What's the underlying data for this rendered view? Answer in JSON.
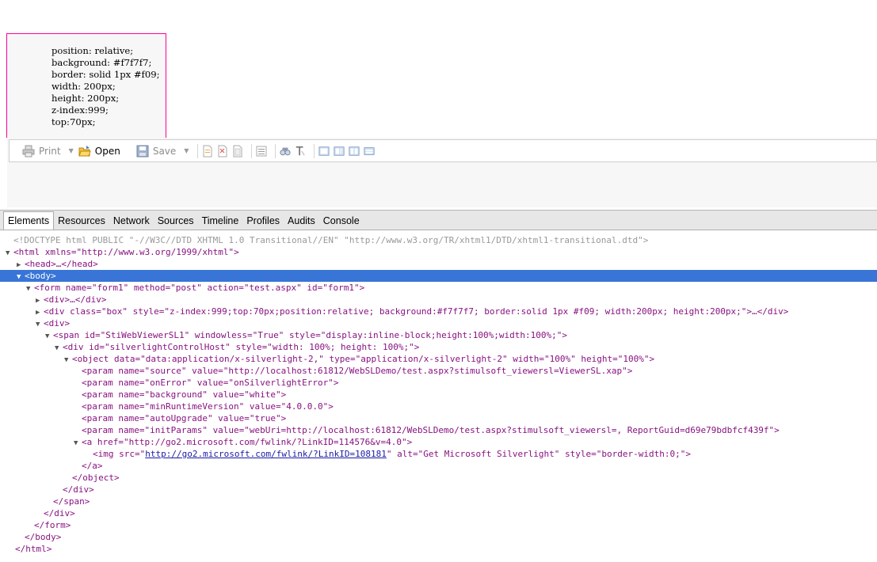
{
  "box": {
    "lines": [
      "position: relative;",
      "background: #f7f7f7;",
      "border: solid 1px #f09;",
      "width: 200px;",
      "height: 200px;",
      "z-index:999;",
      "top:70px;"
    ]
  },
  "toolbar": {
    "print": "Print",
    "open": "Open",
    "save": "Save"
  },
  "devtools": {
    "tabs": [
      "Elements",
      "Resources",
      "Network",
      "Sources",
      "Timeline",
      "Profiles",
      "Audits",
      "Console"
    ],
    "active_tab": "Elements"
  },
  "dom": {
    "doctype": "<!DOCTYPE html PUBLIC \"-//W3C//DTD XHTML 1.0 Transitional//EN\" \"http://www.w3.org/TR/xhtml1/DTD/xhtml1-transitional.dtd\">",
    "html_open": "<html xmlns=\"http://www.w3.org/1999/xhtml\">",
    "head": "<head>…</head>",
    "body_open": "<body>",
    "form_open": "<form name=\"form1\" method=\"post\" action=\"test.aspx\" id=\"form1\">",
    "div_collapsed": "<div>…</div>",
    "div_box": "<div class=\"box\" style=\"z-index:999;top:70px;position:relative; background:#f7f7f7; border:solid 1px #f09; width:200px; height:200px;\">…</div>",
    "div_open": "<div>",
    "span_open": "<span id=\"StiWebViewerSL1\" windowless=\"True\" style=\"display:inline-block;height:100%;width:100%;\">",
    "host_open": "<div id=\"silverlightControlHost\" style=\"width: 100%; height: 100%;\">",
    "object_open": "<object data=\"data:application/x-silverlight-2,\" type=\"application/x-silverlight-2\" width=\"100%\" height=\"100%\">",
    "param_source": "<param name=\"source\" value=\"http://localhost:61812/WebSLDemo/test.aspx?stimulsoft_viewersl=ViewerSL.xap\">",
    "param_onerror": "<param name=\"onError\" value=\"onSilverlightError\">",
    "param_background": "<param name=\"background\" value=\"white\">",
    "param_minruntime": "<param name=\"minRuntimeVersion\" value=\"4.0.0.0\">",
    "param_autoupgrade": "<param name=\"autoUpgrade\" value=\"true\">",
    "param_initparams": "<param name=\"initParams\" value=\"webUri=http://localhost:61812/WebSLDemo/test.aspx?stimulsoft_viewersl=, ReportGuid=d69e79bdbfcf439f\">",
    "a_open": "<a href=\"http://go2.microsoft.com/fwlink/?LinkID=114576&v=4.0\">",
    "img_pre": "<img src=\"",
    "img_link": "http://go2.microsoft.com/fwlink/?LinkID=108181",
    "img_post": "\" alt=\"Get Microsoft Silverlight\" style=\"border-width:0;\">",
    "a_close": "</a>",
    "object_close": "</object>",
    "div_close": "</div>",
    "span_close": "</span>",
    "form_close": "</form>",
    "body_close": "</body>",
    "html_close": "</html>"
  },
  "colors": {
    "tag": "#881280",
    "attr_name": "#994500",
    "attr_value": "#1a1aa6",
    "selection": "#3875d7",
    "box_border": "#ff0099"
  }
}
